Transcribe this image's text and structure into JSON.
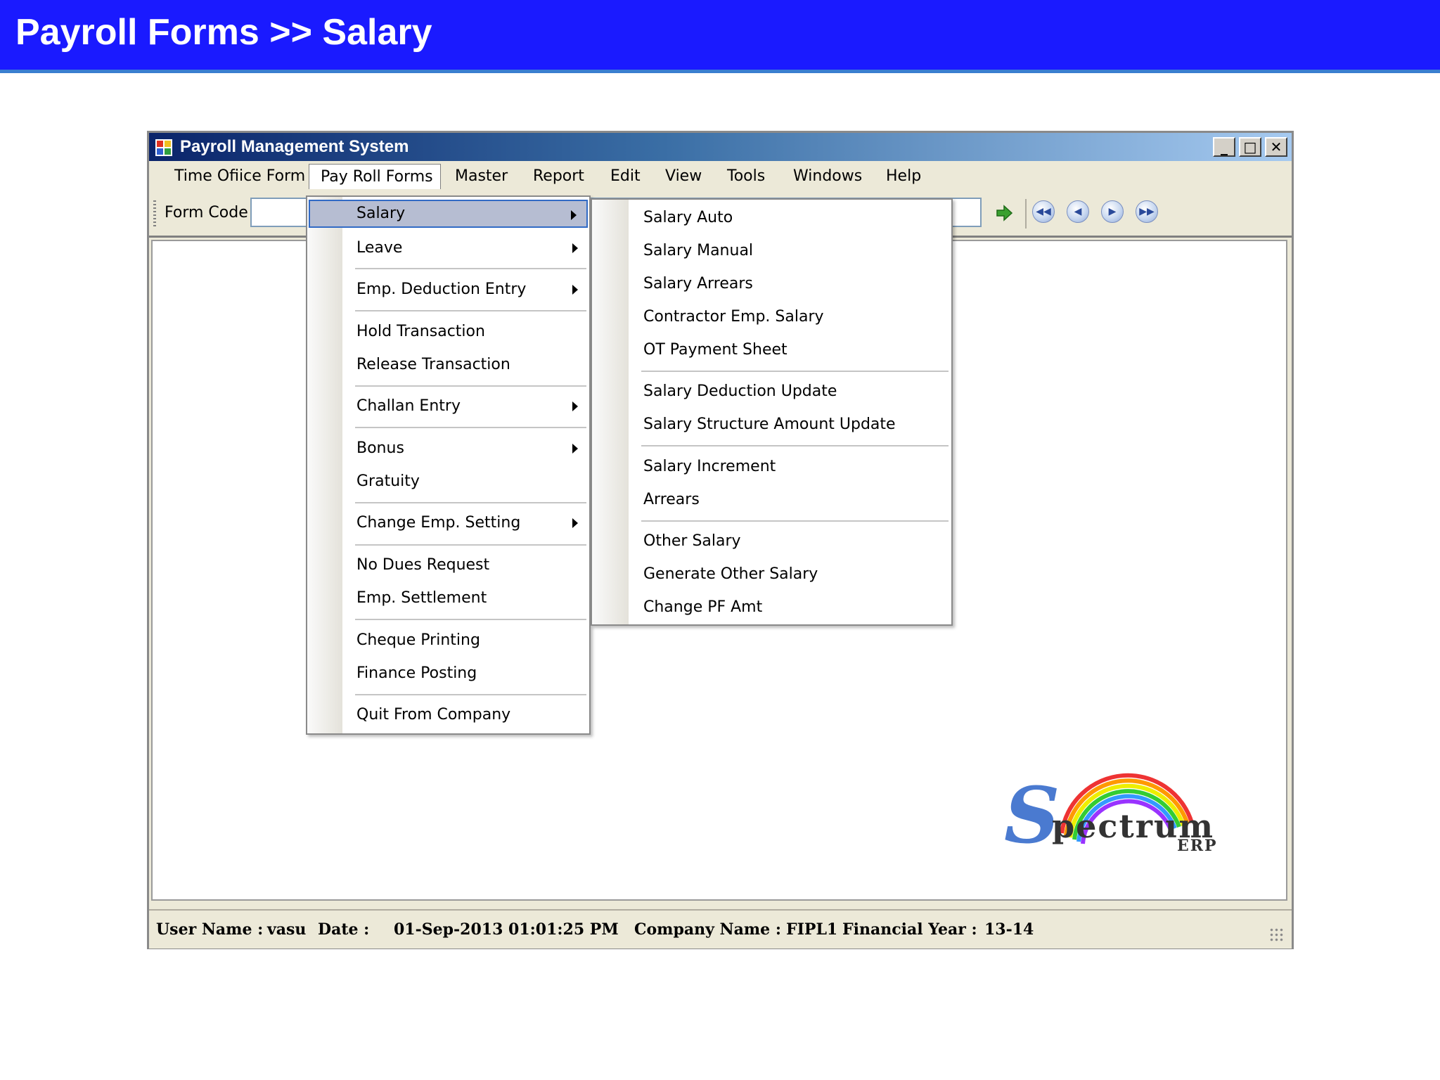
{
  "slide": {
    "title": "Payroll Forms >> Salary"
  },
  "window": {
    "title": "Payroll Management System",
    "controls": {
      "minimize": "_",
      "maximize": "□",
      "close": "✕"
    }
  },
  "menubar": [
    {
      "label": "Time Ofiice Form"
    },
    {
      "label": "Pay Roll Forms"
    },
    {
      "label": "Master"
    },
    {
      "label": "Report"
    },
    {
      "label": "Edit"
    },
    {
      "label": "View"
    },
    {
      "label": "Tools"
    },
    {
      "label": "Windows"
    },
    {
      "label": "Help"
    }
  ],
  "toolbar": {
    "form_code_label": "Form Code",
    "form_code_value": "",
    "icons": [
      "go-arrow-icon",
      "first-record-icon",
      "previous-record-icon",
      "next-record-icon",
      "last-record-icon"
    ]
  },
  "payroll_menu": [
    {
      "label": "Salary",
      "submenu": true,
      "selected": true
    },
    {
      "label": "Leave",
      "submenu": true
    },
    {
      "label": "Emp. Deduction Entry",
      "submenu": true
    },
    {
      "label": "Hold Transaction"
    },
    {
      "label": "Release Transaction"
    },
    {
      "label": "Challan Entry",
      "submenu": true
    },
    {
      "label": "Bonus",
      "submenu": true
    },
    {
      "label": "Gratuity"
    },
    {
      "label": "Change Emp. Setting",
      "submenu": true
    },
    {
      "label": "No Dues Request"
    },
    {
      "label": "Emp. Settlement"
    },
    {
      "label": "Cheque Printing"
    },
    {
      "label": "Finance Posting"
    },
    {
      "label": "Quit From Company"
    }
  ],
  "salary_submenu": [
    {
      "label": "Salary Auto"
    },
    {
      "label": "Salary Manual"
    },
    {
      "label": "Salary Arrears"
    },
    {
      "label": "Contractor Emp. Salary"
    },
    {
      "label": "OT Payment Sheet"
    },
    {
      "label": "Salary Deduction Update"
    },
    {
      "label": "Salary Structure Amount Update"
    },
    {
      "label": "Salary Increment"
    },
    {
      "label": "Arrears"
    },
    {
      "label": "Other Salary"
    },
    {
      "label": "Generate Other Salary"
    },
    {
      "label": "Change PF Amt"
    }
  ],
  "statusbar": {
    "user_label": "User Name :",
    "user_value": "vasu",
    "date_label": "Date :",
    "date_value": "01-Sep-2013 01:01:25 PM",
    "company_label": "Company Name :",
    "company_value": "FIPL1",
    "fy_label": "Financial Year :",
    "fy_value": "13-14"
  },
  "logo": {
    "big_letter": "S",
    "word": "pectrum",
    "suffix": "ERP"
  },
  "colors": {
    "banner": "#1a1aff",
    "selection": "#b6bdd2",
    "selection_border": "#316ac5"
  }
}
